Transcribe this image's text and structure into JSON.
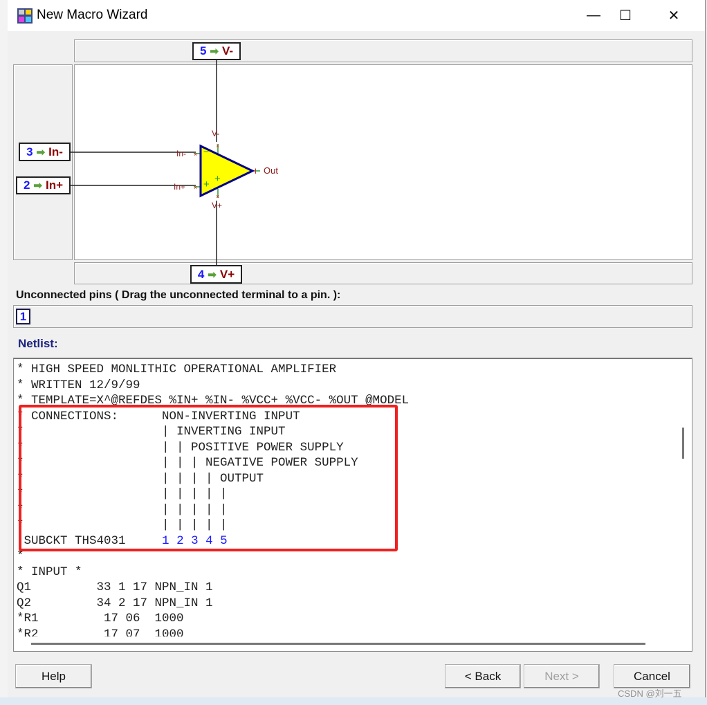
{
  "window": {
    "title": "New Macro Wizard",
    "controls": {
      "minimize": "—",
      "maximize": "☐",
      "close": "✕"
    }
  },
  "schematic": {
    "pins": [
      {
        "number": "5",
        "name": "V-"
      },
      {
        "number": "3",
        "name": "In-"
      },
      {
        "number": "2",
        "name": "In+"
      },
      {
        "number": "4",
        "name": "V+"
      }
    ],
    "symbol_labels": {
      "vminus": "V-",
      "vplus": "V+",
      "inminus": "In-",
      "inplus": "In+",
      "out": "Out",
      "minus_sign": "−",
      "plus_sign": "+"
    },
    "arrow": "➡",
    "colors": {
      "triangle_fill": "#ffff00",
      "triangle_stroke": "#00008b",
      "pin_number": "#1a1aff",
      "pin_name": "#8b0000",
      "arrow": "#5aa13a"
    }
  },
  "unconnected": {
    "label": "Unconnected pins ( Drag the unconnected terminal to a pin. ):",
    "pins": [
      "1"
    ]
  },
  "netlist": {
    "label": "Netlist:",
    "lines": [
      "* HIGH SPEED MONLITHIC OPERATIONAL AMPLIFIER",
      "* WRITTEN 12/9/99",
      "* TEMPLATE=X^@REFDES %IN+ %IN- %VCC+ %VCC- %OUT @MODEL",
      "* CONNECTIONS:      NON-INVERTING INPUT",
      "*                   | INVERTING INPUT",
      "*                   | | POSITIVE POWER SUPPLY",
      "*                   | | | NEGATIVE POWER SUPPLY",
      "*                   | | | | OUTPUT",
      "*                   | | | | |",
      "*                   | | | | |",
      "*                   | | | | |"
    ],
    "subckt": {
      "prefix": ".SUBCKT THS4031     ",
      "pins": [
        "1",
        "2",
        "3",
        "4",
        "5"
      ]
    },
    "lines_after": [
      "*",
      "* INPUT *",
      "Q1         33 1 17 NPN_IN 1",
      "Q2         34 2 17 NPN_IN 1",
      "*R1         17 06  1000",
      "*R2         17 07  1000"
    ],
    "highlight_color": "#f02020"
  },
  "buttons": {
    "help": "Help",
    "back": "< Back",
    "next": "Next >",
    "cancel": "Cancel"
  },
  "watermark": "CSDN @刘一五"
}
